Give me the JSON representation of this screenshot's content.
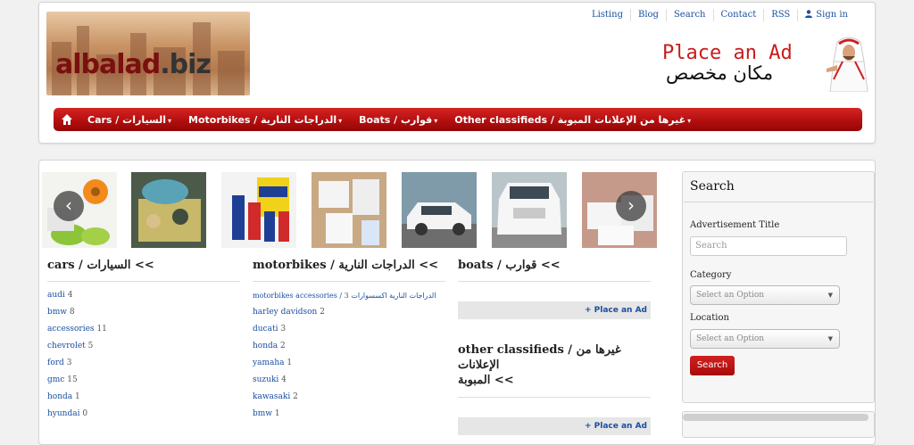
{
  "header": {
    "logo_text_main": "albalad",
    "logo_text_tld": ".biz",
    "top_links": [
      "Listing",
      "Blog",
      "Search",
      "Contact",
      "RSS",
      "Sign in"
    ],
    "place_ad_en": "Place an Ad",
    "place_ad_ar": "مكان مخصص"
  },
  "nav": {
    "home_icon": "home-icon",
    "items": [
      "Cars / السيارات",
      "Motorbikes / الدراجات النارية",
      "Boats / قوارب",
      "Other classifieds / غيرها من الإعلانات المبوبة"
    ]
  },
  "carousel": {
    "prev": "‹",
    "next": "›"
  },
  "columns": [
    {
      "title": "cars / السيارات <<",
      "items": [
        {
          "name": "audi",
          "count": "4"
        },
        {
          "name": "bmw",
          "count": "8"
        },
        {
          "name": "accessories",
          "count": "11"
        },
        {
          "name": "chevrolet",
          "count": "5"
        },
        {
          "name": "ford",
          "count": "3"
        },
        {
          "name": "gmc",
          "count": "15"
        },
        {
          "name": "honda",
          "count": "1"
        },
        {
          "name": "hyundai",
          "count": "0"
        }
      ]
    },
    {
      "title": "motorbikes / الدراجات النارية <<",
      "items": [
        {
          "name": "motorbikes accessories / الدراجات النارية اكسسوارات",
          "count": "3"
        },
        {
          "name": "harley davidson",
          "count": "2"
        },
        {
          "name": "ducati",
          "count": "3"
        },
        {
          "name": "honda",
          "count": "2"
        },
        {
          "name": "yamaha",
          "count": "1"
        },
        {
          "name": "suzuki",
          "count": "4"
        },
        {
          "name": "kawasaki",
          "count": "2"
        },
        {
          "name": "bmw",
          "count": "1"
        }
      ]
    },
    {
      "title": "boats / قوارب <<",
      "place_ad": "+ Place an Ad",
      "title2_line1": "other classifieds / غيرها من الإعلانات",
      "title2_line2": "المبوبة <<",
      "place_ad2": "+ Place an Ad"
    }
  ],
  "sidebar": {
    "title": "Search",
    "ad_title_label": "Advertisement Title",
    "search_placeholder": "Search",
    "category_label": "Category",
    "category_value": "Select an Option",
    "location_label": "Location",
    "location_value": "Select an Option",
    "search_button": "Search"
  },
  "colors": {
    "brand_red": "#b30f0f",
    "link_blue": "#1a4fa0"
  }
}
